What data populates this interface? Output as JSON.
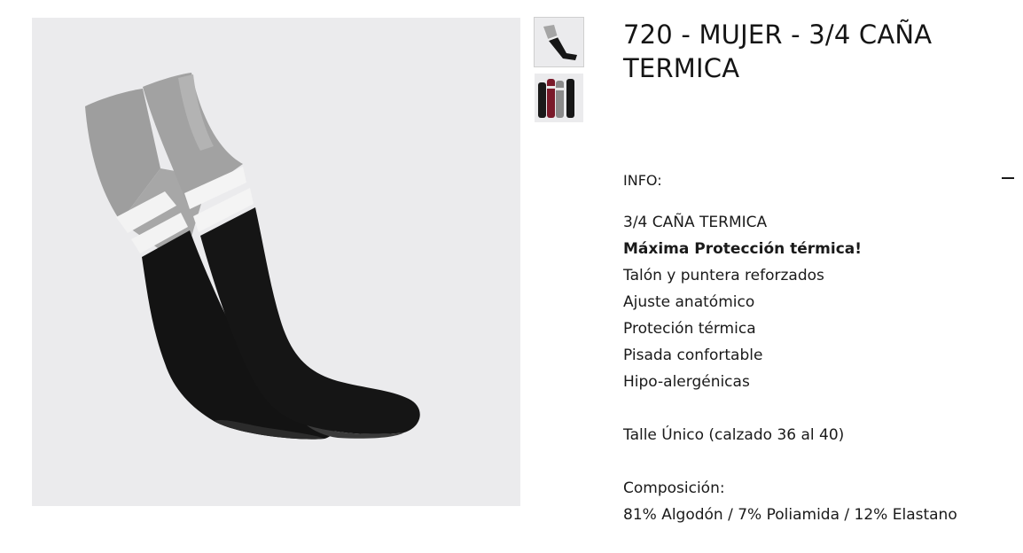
{
  "product": {
    "title_line1": "720 - MUJER - 3/4 CAÑA",
    "title_line2": "TERMICA"
  },
  "gallery": {
    "main_image": "knee-high-socks-photo",
    "thumbnails": [
      {
        "name": "socks-pair-thumbnail",
        "selected": true
      },
      {
        "name": "socks-colors-thumbnail",
        "selected": false
      }
    ]
  },
  "info": {
    "label": "INFO:",
    "toggle_icon": "minus-icon",
    "lines": [
      "3/4 CAÑA TERMICA",
      "Máxima Protección térmica!",
      "Talón y puntera reforzados",
      "Ajuste anatómico",
      "Proteción térmica",
      "Pisada confortable",
      "Hipo-alergénicas"
    ],
    "size": "Talle Único (calzado 36 al 40)",
    "composition_label": "Composición:",
    "composition": "81% Algodón / 7% Poliamida / 12% Elastano"
  },
  "colors": {
    "background": "#ffffff",
    "image_bg": "#ebebed",
    "sock_gray": "#a3a3a3",
    "sock_black": "#141414",
    "stripe_white": "#f4f4f4",
    "text": "#1a1a1a"
  }
}
